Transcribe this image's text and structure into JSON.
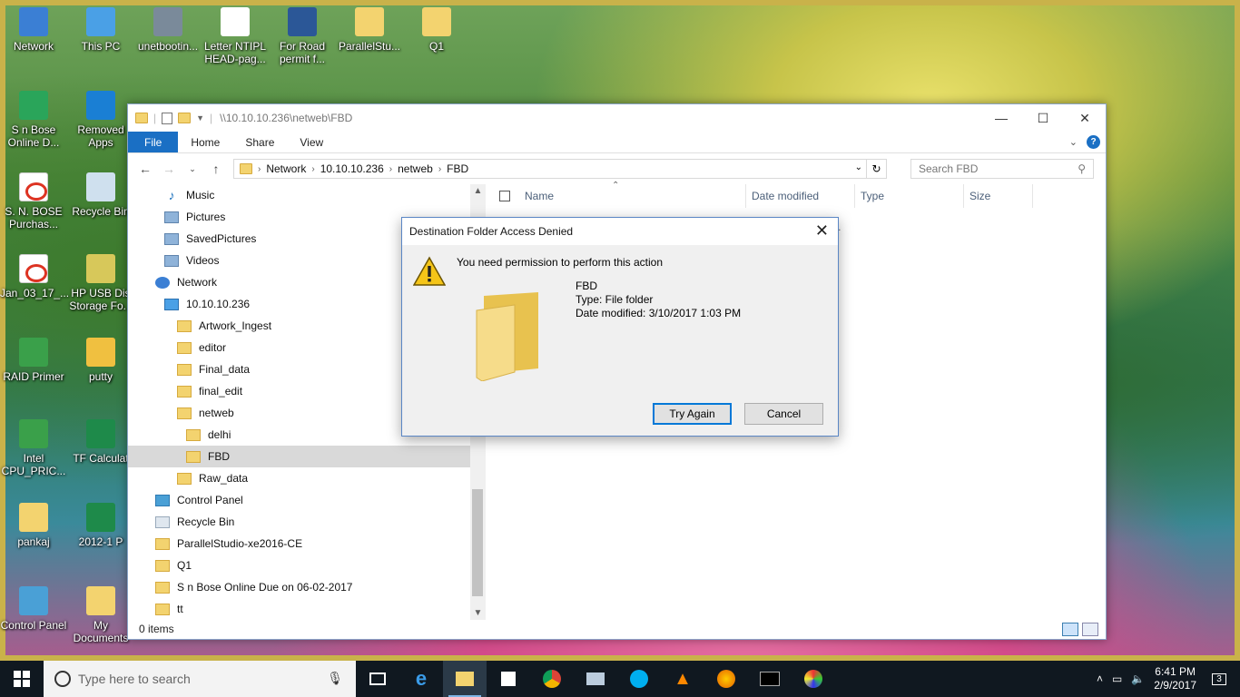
{
  "desktop": {
    "icons": [
      {
        "label": "Network"
      },
      {
        "label": "This PC"
      },
      {
        "label": "unetbootin..."
      },
      {
        "label": "Letter NTIPL HEAD-pag..."
      },
      {
        "label": "For Road permit f..."
      },
      {
        "label": "ParallelStu..."
      },
      {
        "label": "Q1"
      },
      {
        "label": "S n Bose Online D..."
      },
      {
        "label": "Removed Apps"
      },
      {
        "label": "S. N. BOSE Purchas..."
      },
      {
        "label": "Recycle Bin"
      },
      {
        "label": "Jan_03_17_..."
      },
      {
        "label": "HP USB Dis Storage Fo..."
      },
      {
        "label": "RAID Primer"
      },
      {
        "label": "putty"
      },
      {
        "label": "Intel CPU_PRIC..."
      },
      {
        "label": "TF Calculat"
      },
      {
        "label": "pankaj"
      },
      {
        "label": "2012-1 P"
      },
      {
        "label": "Control Panel"
      },
      {
        "label": "My Documents"
      }
    ]
  },
  "explorer": {
    "title_path": "\\\\10.10.10.236\\netweb\\FBD",
    "window_controls": {
      "minimize": "—",
      "maximize": "☐",
      "close": "✕"
    },
    "ribbon_tabs": [
      "File",
      "Home",
      "Share",
      "View"
    ],
    "breadcrumb": [
      "Network",
      "10.10.10.236",
      "netweb",
      "FBD"
    ],
    "search_placeholder": "Search FBD",
    "nav_tree": [
      {
        "label": "Music",
        "icon": "music-icon",
        "indent": 1
      },
      {
        "label": "Pictures",
        "icon": "pictures-icon",
        "indent": 1
      },
      {
        "label": "SavedPictures",
        "icon": "pictures-icon",
        "indent": 1
      },
      {
        "label": "Videos",
        "icon": "videos-icon",
        "indent": 1
      },
      {
        "label": "Network",
        "icon": "network-icon",
        "indent": 0
      },
      {
        "label": "10.10.10.236",
        "icon": "computer-icon",
        "indent": 1
      },
      {
        "label": "Artwork_Ingest",
        "icon": "folder-icon",
        "indent": 2
      },
      {
        "label": "editor",
        "icon": "folder-icon",
        "indent": 2
      },
      {
        "label": "Final_data",
        "icon": "folder-icon",
        "indent": 2
      },
      {
        "label": "final_edit",
        "icon": "folder-icon",
        "indent": 2
      },
      {
        "label": "netweb",
        "icon": "folder-icon",
        "indent": 2
      },
      {
        "label": "delhi",
        "icon": "folder-icon",
        "indent": 3
      },
      {
        "label": "FBD",
        "icon": "folder-icon",
        "indent": 3,
        "selected": true
      },
      {
        "label": "Raw_data",
        "icon": "folder-icon",
        "indent": 2
      },
      {
        "label": "Control Panel",
        "icon": "control-panel-icon",
        "indent": 0
      },
      {
        "label": "Recycle Bin",
        "icon": "recycle-bin-icon",
        "indent": 0
      },
      {
        "label": "ParallelStudio-xe2016-CE",
        "icon": "folder-icon",
        "indent": 0
      },
      {
        "label": "Q1",
        "icon": "folder-icon",
        "indent": 0
      },
      {
        "label": "S n Bose Online Due on 06-02-2017",
        "icon": "folder-icon",
        "indent": 0
      },
      {
        "label": "tt",
        "icon": "folder-icon",
        "indent": 0
      }
    ],
    "columns": [
      "Name",
      "Date modified",
      "Type",
      "Size"
    ],
    "empty_text_fragment": "y.",
    "status": "0 items"
  },
  "dialog": {
    "title": "Destination Folder Access Denied",
    "message": "You need permission to perform this action",
    "item_name": "FBD",
    "item_type": "Type: File folder",
    "item_date": "Date modified: 3/10/2017 1:03 PM",
    "try_again": "Try Again",
    "cancel": "Cancel",
    "close": "✕"
  },
  "taskbar": {
    "search_placeholder": "Type here to search",
    "time": "6:41 PM",
    "date": "2/9/2017",
    "notifications": "3",
    "pinned": [
      "task-view",
      "edge",
      "file-explorer",
      "store",
      "chrome",
      "mail",
      "skype",
      "vlc",
      "firefox",
      "cmd",
      "paint"
    ]
  }
}
